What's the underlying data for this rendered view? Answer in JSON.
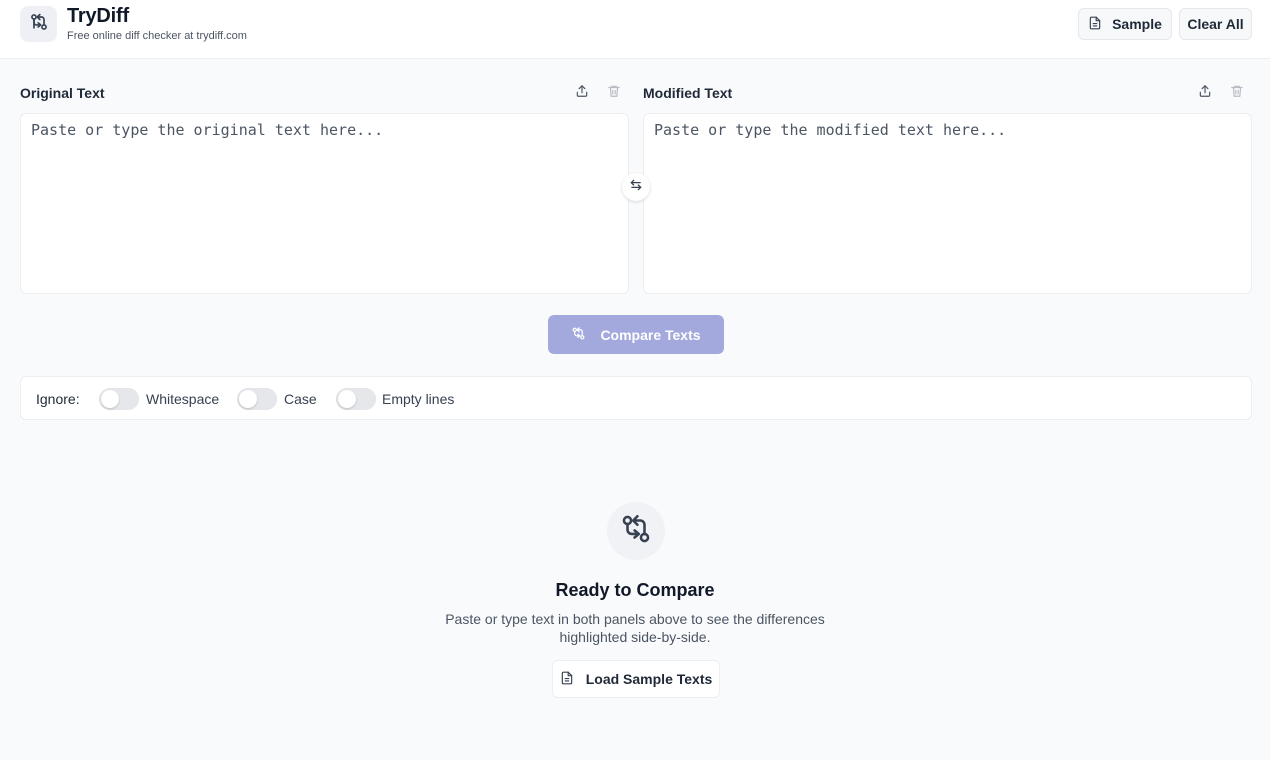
{
  "header": {
    "title": "TryDiff",
    "subtitle": "Free online diff checker at trydiff.com",
    "logo_icon": "git-compare-icon",
    "sample_label": "Sample",
    "sample_icon": "document-icon",
    "clear_label": "Clear All"
  },
  "original": {
    "label": "Original Text",
    "placeholder": "Paste or type the original text here...",
    "value": "",
    "upload_icon": "upload-icon",
    "delete_icon": "trash-icon"
  },
  "modified": {
    "label": "Modified Text",
    "placeholder": "Paste or type the modified text here...",
    "value": "",
    "upload_icon": "upload-icon",
    "delete_icon": "trash-icon"
  },
  "swap": {
    "icon": "swap-arrows-icon"
  },
  "compare": {
    "label": "Compare Texts",
    "icon": "git-compare-icon",
    "enabled": false
  },
  "ignore": {
    "label": "Ignore:",
    "options": [
      {
        "label": "Whitespace",
        "checked": false
      },
      {
        "label": "Case",
        "checked": false
      },
      {
        "label": "Empty lines",
        "checked": false
      }
    ]
  },
  "empty_state": {
    "icon": "git-compare-icon",
    "title": "Ready to Compare",
    "description": "Paste or type text in both panels above to see the differences highlighted side-by-side.",
    "load_label": "Load Sample Texts",
    "load_icon": "document-icon"
  },
  "colors": {
    "accent_disabled": "#a3a9dc",
    "background": "#f9fafb",
    "text_primary": "#111827",
    "text_secondary": "#4b5563"
  }
}
